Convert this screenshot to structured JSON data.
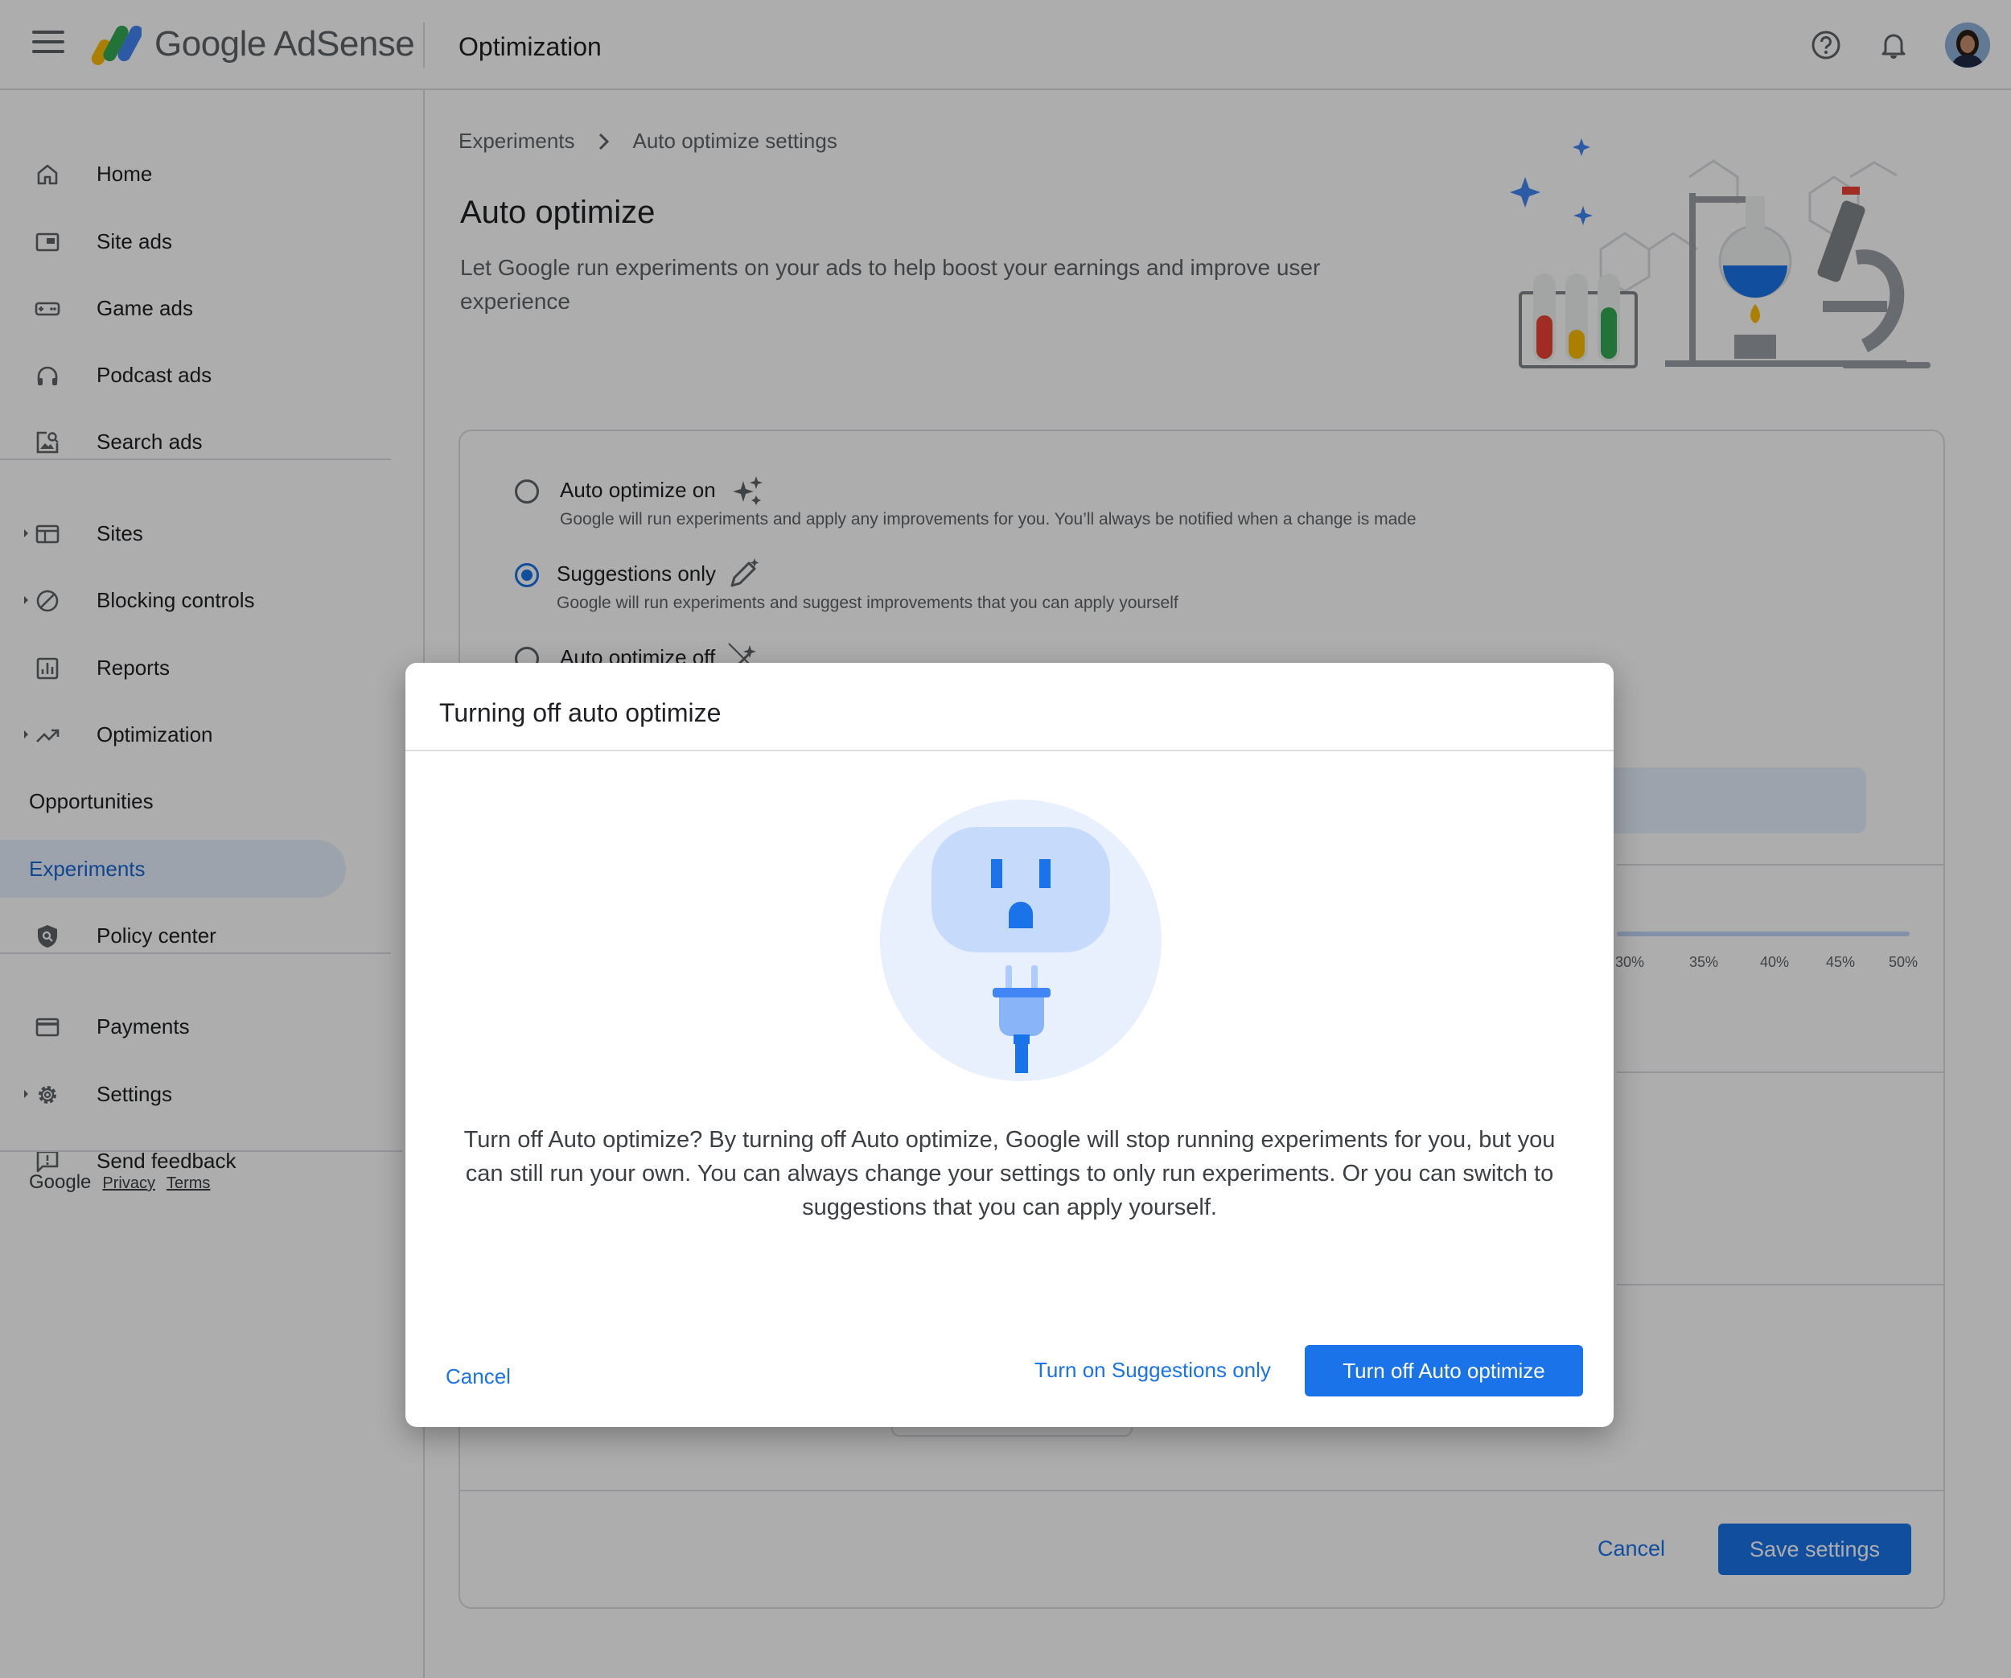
{
  "app": {
    "brand": "Google AdSense",
    "section_title": "Optimization",
    "icons": {
      "menu": "menu-icon",
      "help": "help-icon",
      "notifications": "bell-icon"
    }
  },
  "sidebar": {
    "items": [
      {
        "label": "Home",
        "icon": "home-icon"
      },
      {
        "label": "Site ads",
        "icon": "site-ads-icon"
      },
      {
        "label": "Game ads",
        "icon": "game-ads-icon"
      },
      {
        "label": "Podcast ads",
        "icon": "headphones-icon"
      },
      {
        "label": "Search ads",
        "icon": "search-ads-icon"
      },
      {
        "label": "Sites",
        "icon": "sites-icon"
      },
      {
        "label": "Blocking controls",
        "icon": "block-icon"
      },
      {
        "label": "Reports",
        "icon": "reports-icon"
      },
      {
        "label": "Optimization",
        "icon": "trending-icon"
      },
      {
        "label": "Opportunities"
      },
      {
        "label": "Experiments",
        "active": true
      },
      {
        "label": "Policy center",
        "icon": "shield-icon"
      },
      {
        "label": "Payments",
        "icon": "card-icon"
      },
      {
        "label": "Settings",
        "icon": "gear-icon"
      },
      {
        "label": "Send feedback",
        "icon": "feedback-icon"
      }
    ],
    "footer": {
      "brand": "Google",
      "privacy": "Privacy",
      "terms": "Terms"
    }
  },
  "breadcrumb": {
    "parent": "Experiments",
    "current": "Auto optimize settings"
  },
  "page": {
    "title": "Auto optimize",
    "description": "Let Google run experiments on your ads to help boost your earnings and improve user experience"
  },
  "options": [
    {
      "label": "Auto optimize on",
      "description": "Google will run experiments and apply any improvements for you. You’ll always be notified when a change is made",
      "selected": false,
      "icon": "sparkle-icon"
    },
    {
      "label": "Suggestions only",
      "description": "Google will run experiments and suggest improvements that you can apply yourself",
      "selected": true,
      "icon": "pencil-sparkle-icon"
    },
    {
      "label": "Auto optimize off",
      "selected": false,
      "icon": "wand-off-icon"
    }
  ],
  "background_scale": [
    "30%",
    "35%",
    "40%",
    "45%",
    "50%"
  ],
  "card_footer": {
    "cancel": "Cancel",
    "save": "Save settings"
  },
  "dialog": {
    "title": "Turning off auto optimize",
    "body": "Turn off Auto optimize? By turning off Auto optimize, Google will stop running experiments for you, but you can still run your own. You can always change your settings to only run experiments. Or you can switch to suggestions that you can apply yourself.",
    "cancel": "Cancel",
    "secondary": "Turn on Suggestions only",
    "primary": "Turn off Auto optimize",
    "illustration": "power-outlet-plug"
  },
  "colors": {
    "accent": "#1a73e8",
    "active_nav_bg": "#e8f0fe",
    "scrim": "rgba(0,0,0,0.32)"
  }
}
